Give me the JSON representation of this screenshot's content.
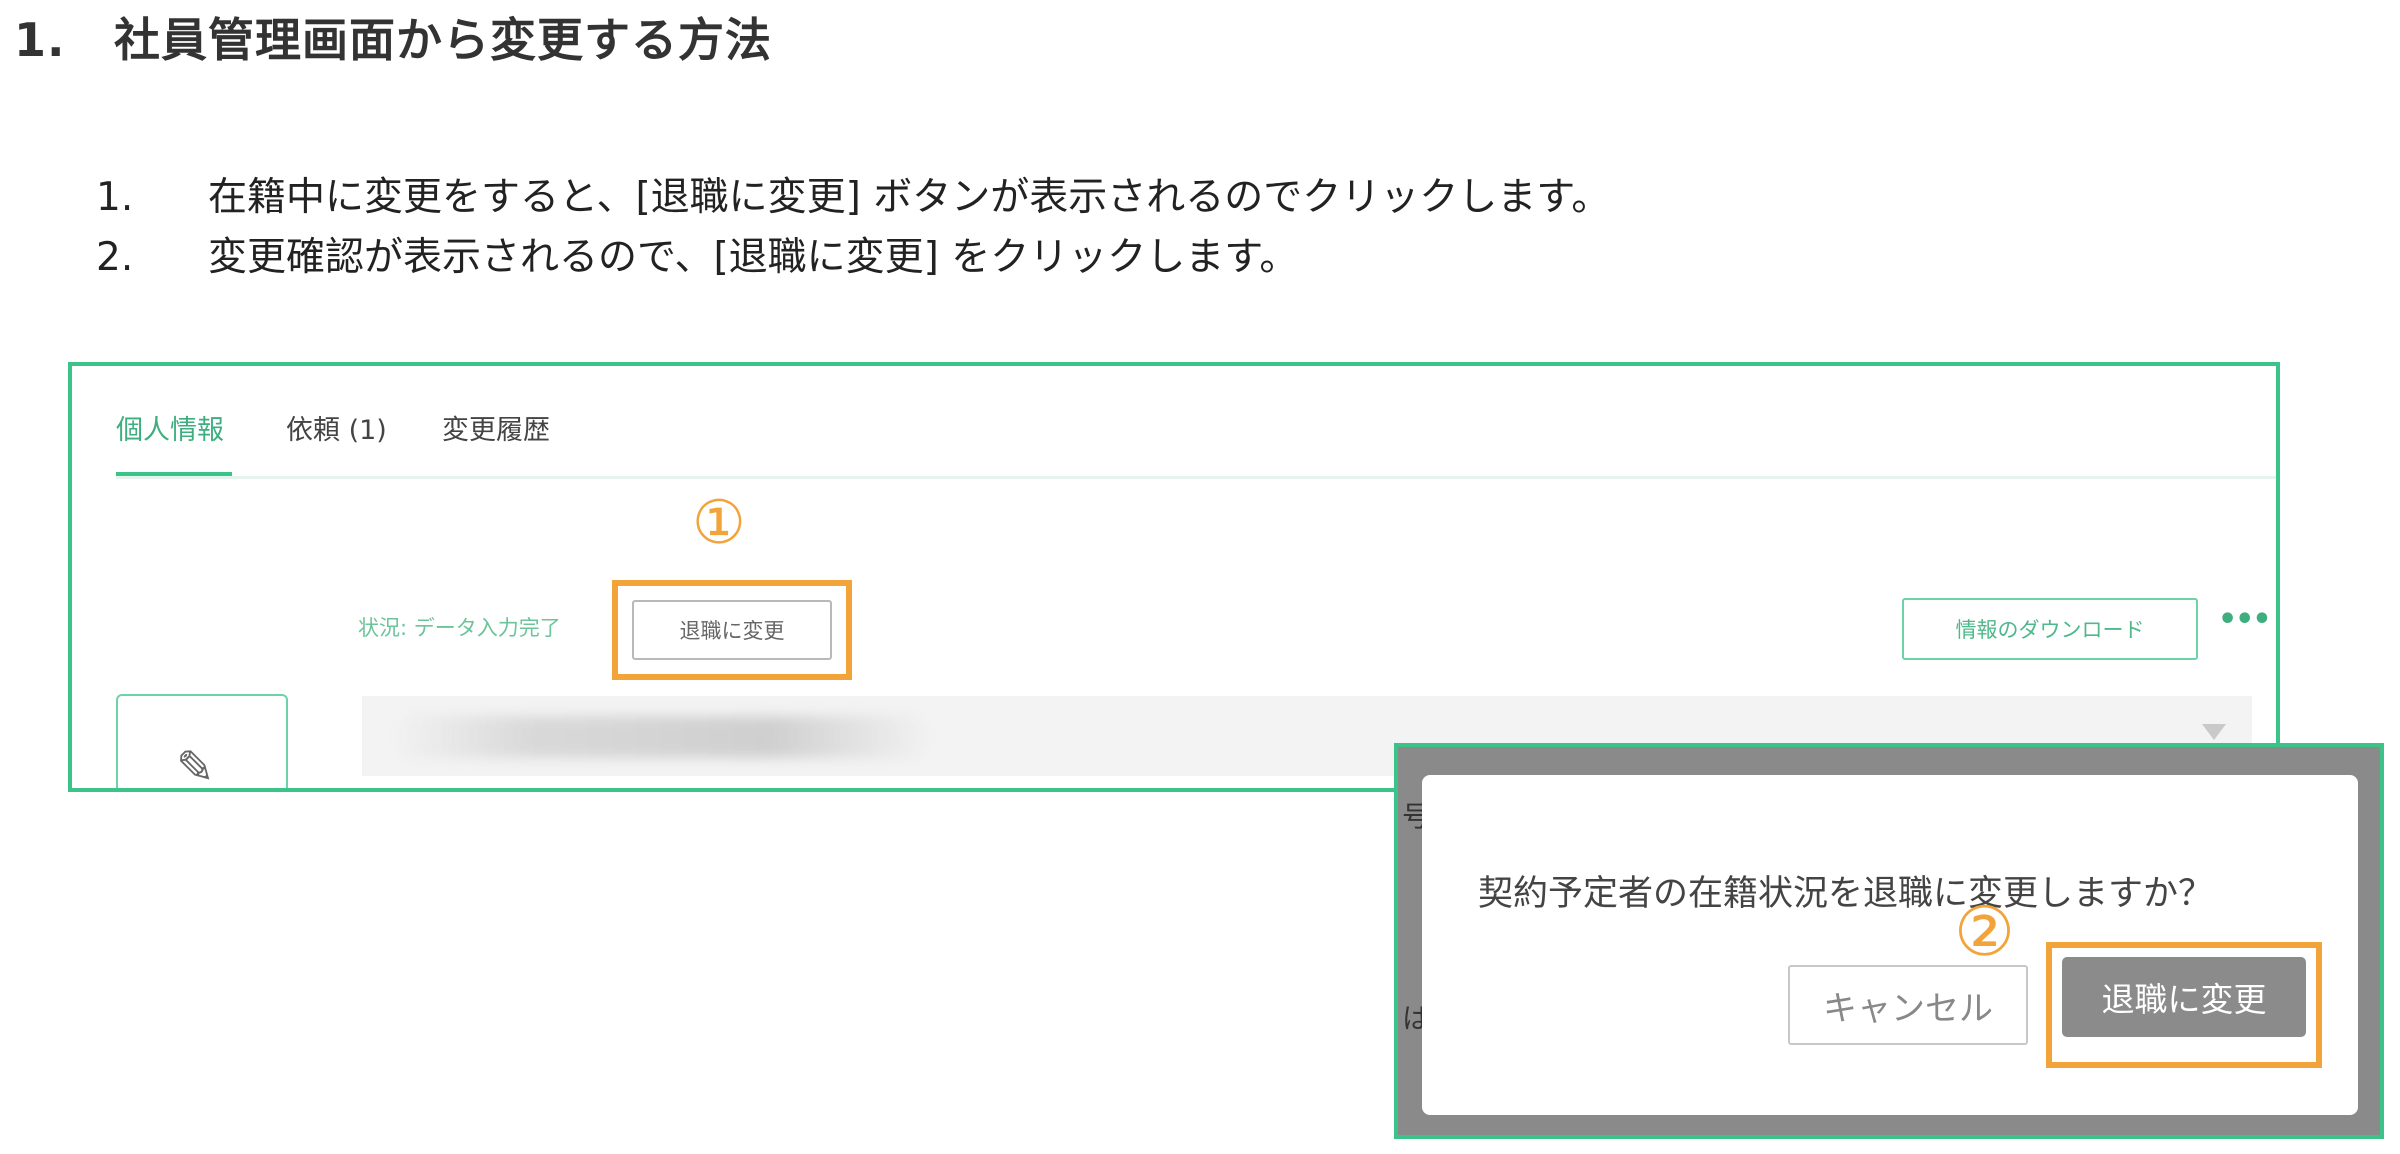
{
  "heading": {
    "number": "1.",
    "title": "社員管理画面から変更する方法"
  },
  "steps": [
    {
      "n": "1.",
      "text": "在籍中に変更をすると、[退職に変更] ボタンが表示されるのでクリックします。"
    },
    {
      "n": "2.",
      "text": "変更確認が表示されるので、[退職に変更] をクリックします。"
    }
  ],
  "screenshot1": {
    "tabs": [
      {
        "label": "個人情報",
        "active": true
      },
      {
        "label": "依頼 (1)",
        "active": false
      },
      {
        "label": "変更履歴",
        "active": false
      }
    ],
    "marker": "①",
    "status_text": "状況: データ入力完了",
    "retire_button": "退職に変更",
    "download_button": "情報のダウンロード",
    "more_menu": "•••"
  },
  "screenshot2": {
    "background_char_1": "号",
    "background_char_2": "は",
    "dialog_message": "契約予定者の在籍状況を退職に変更しますか？",
    "marker": "②",
    "cancel_button": "キャンセル",
    "confirm_button": "退職に変更"
  },
  "colors": {
    "frame": "#3cc38a",
    "highlight": "#f2a33a",
    "accent_text": "#3fae7f"
  }
}
